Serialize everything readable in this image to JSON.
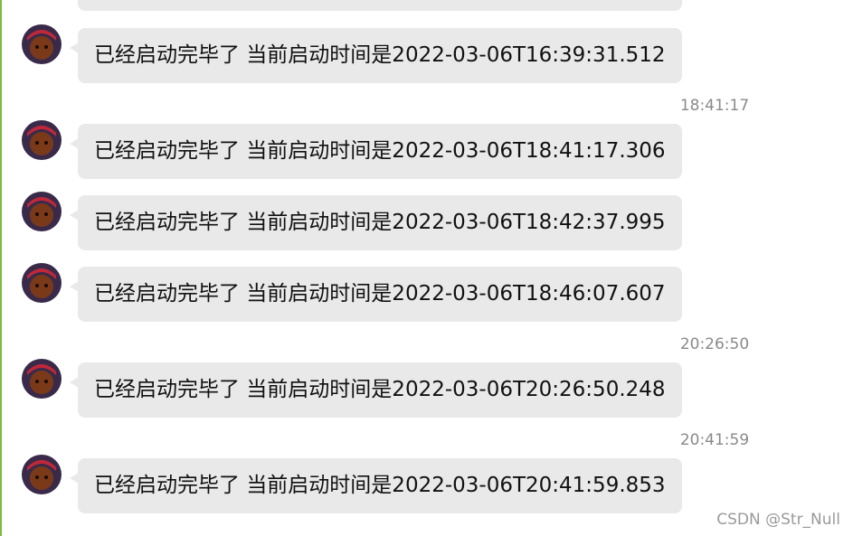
{
  "messages": [
    {
      "text": "已经启动完毕了 当前启动时间是2022-03-06T16:39:31.512"
    },
    {
      "text": "已经启动完毕了 当前启动时间是2022-03-06T18:41:17.306"
    },
    {
      "text": "已经启动完毕了 当前启动时间是2022-03-06T18:42:37.995"
    },
    {
      "text": "已经启动完毕了 当前启动时间是2022-03-06T18:46:07.607"
    },
    {
      "text": "已经启动完毕了 当前启动时间是2022-03-06T20:26:50.248"
    },
    {
      "text": "已经启动完毕了 当前启动时间是2022-03-06T20:41:59.853"
    }
  ],
  "timestamps": [
    "18:41:17",
    "20:26:50",
    "20:41:59"
  ],
  "watermark": "CSDN @Str_Null",
  "colors": {
    "bubble": "#e9e9e9",
    "left_border": "#7dbb3a",
    "timestamp": "#8a8a8a"
  }
}
